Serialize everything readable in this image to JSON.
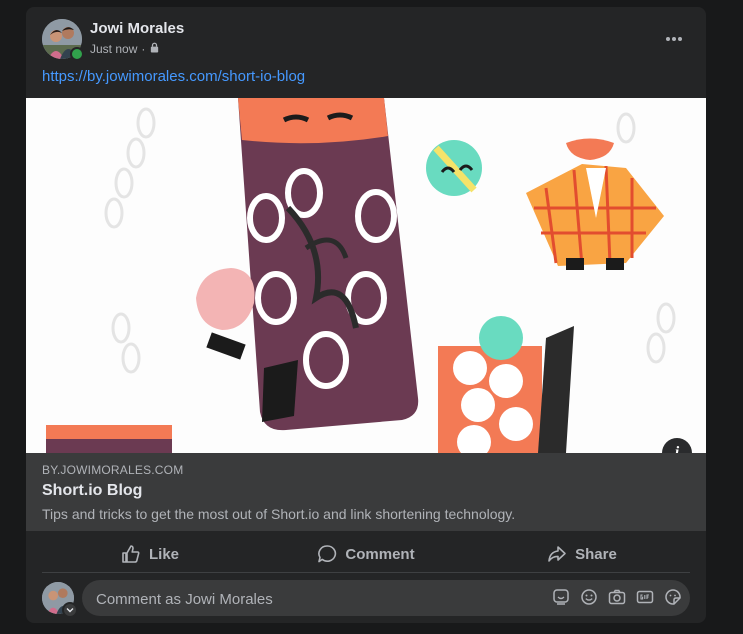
{
  "post": {
    "author": "Jowi Morales",
    "timestamp": "Just now",
    "separator": "·",
    "privacy_icon": "lock-icon",
    "more_icon": "more-horizontal-icon",
    "link_text": "https://by.jowimorales.com/short-io-blog"
  },
  "preview": {
    "domain": "BY.JOWIMORALES.COM",
    "title": "Short.io Blog",
    "description": "Tips and tricks to get the most out of Short.io and link shortening technology.",
    "info_icon": "i"
  },
  "actions": [
    {
      "label": "Like",
      "icon": "thumbs-up-icon"
    },
    {
      "label": "Comment",
      "icon": "speech-bubble-icon"
    },
    {
      "label": "Share",
      "icon": "share-arrow-icon"
    }
  ],
  "comment": {
    "placeholder": "Comment as Jowi Morales",
    "icons": [
      "avatar-sticker-icon",
      "emoji-icon",
      "camera-icon",
      "gif-icon",
      "sticker-icon"
    ]
  },
  "colors": {
    "background": "#18191a",
    "card": "#242526",
    "link": "#4599ff",
    "online": "#31a24c"
  }
}
